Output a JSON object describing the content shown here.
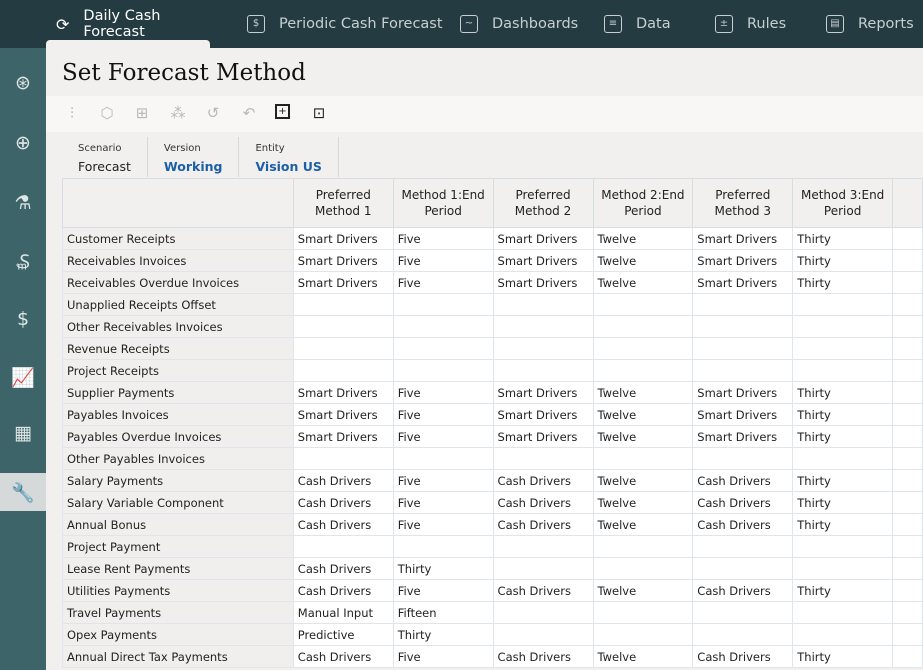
{
  "nav": {
    "tabs": [
      {
        "label": "Daily Cash Forecast",
        "icon": "cash-cycle-icon",
        "active": true
      },
      {
        "label": "Periodic Cash Forecast",
        "icon": "calendar-dollar-icon"
      },
      {
        "label": "Dashboards",
        "icon": "monitor-chart-icon"
      },
      {
        "label": "Data",
        "icon": "table-icon"
      },
      {
        "label": "Rules",
        "icon": "calculator-icon"
      },
      {
        "label": "Reports",
        "icon": "report-icon"
      }
    ]
  },
  "sidebar": {
    "items": [
      {
        "icon": "cash-flow-icon"
      },
      {
        "icon": "add-circle-icon"
      },
      {
        "icon": "lab-flask-icon"
      },
      {
        "icon": "invoice-dollar-icon"
      },
      {
        "icon": "balance-dollar-icon"
      },
      {
        "icon": "line-chart-icon"
      },
      {
        "icon": "grid-icon"
      },
      {
        "icon": "wrench-icon",
        "active": true
      }
    ]
  },
  "page": {
    "title": "Set Forecast Method"
  },
  "toolbar": {
    "icons": [
      "adjust-sliders-icon",
      "cube-icon",
      "add-comment-icon",
      "hierarchy-icon",
      "history-icon",
      "undo-icon",
      "grid-focus-icon",
      "panel-export-icon"
    ]
  },
  "pov": {
    "scenario_label": "Scenario",
    "scenario": "Forecast",
    "version_label": "Version",
    "version": "Working",
    "entity_label": "Entity",
    "entity": "Vision US"
  },
  "grid": {
    "columns": [
      "Preferred Method 1",
      "Method 1:End Period",
      "Preferred Method 2",
      "Method 2:End Period",
      "Preferred Method 3",
      "Method 3:End Period"
    ],
    "rows": [
      [
        "Customer Receipts",
        "Smart Drivers",
        "Five",
        "Smart Drivers",
        "Twelve",
        "Smart Drivers",
        "Thirty"
      ],
      [
        "Receivables Invoices",
        "Smart Drivers",
        "Five",
        "Smart Drivers",
        "Twelve",
        "Smart Drivers",
        "Thirty"
      ],
      [
        "Receivables Overdue Invoices",
        "Smart Drivers",
        "Five",
        "Smart Drivers",
        "Twelve",
        "Smart Drivers",
        "Thirty"
      ],
      [
        "Unapplied Receipts Offset",
        "",
        "",
        "",
        "",
        "",
        ""
      ],
      [
        "Other Receivables Invoices",
        "",
        "",
        "",
        "",
        "",
        ""
      ],
      [
        "Revenue Receipts",
        "",
        "",
        "",
        "",
        "",
        ""
      ],
      [
        "Project Receipts",
        "",
        "",
        "",
        "",
        "",
        ""
      ],
      [
        "Supplier Payments",
        "Smart Drivers",
        "Five",
        "Smart Drivers",
        "Twelve",
        "Smart Drivers",
        "Thirty"
      ],
      [
        "Payables Invoices",
        "Smart Drivers",
        "Five",
        "Smart Drivers",
        "Twelve",
        "Smart Drivers",
        "Thirty"
      ],
      [
        "Payables Overdue Invoices",
        "Smart Drivers",
        "Five",
        "Smart Drivers",
        "Twelve",
        "Smart Drivers",
        "Thirty"
      ],
      [
        "Other Payables Invoices",
        "",
        "",
        "",
        "",
        "",
        ""
      ],
      [
        "Salary Payments",
        "Cash Drivers",
        "Five",
        "Cash Drivers",
        "Twelve",
        "Cash Drivers",
        "Thirty"
      ],
      [
        "Salary Variable Component",
        "Cash Drivers",
        "Five",
        "Cash Drivers",
        "Twelve",
        "Cash Drivers",
        "Thirty"
      ],
      [
        "Annual Bonus",
        "Cash Drivers",
        "Five",
        "Cash Drivers",
        "Twelve",
        "Cash Drivers",
        "Thirty"
      ],
      [
        "Project Payment",
        "",
        "",
        "",
        "",
        "",
        ""
      ],
      [
        "Lease Rent Payments",
        "Cash Drivers",
        "Thirty",
        "",
        "",
        "",
        ""
      ],
      [
        "Utilities Payments",
        "Cash Drivers",
        "Five",
        "Cash Drivers",
        "Twelve",
        "Cash Drivers",
        "Thirty"
      ],
      [
        "Travel Payments",
        "Manual Input",
        "Fifteen",
        "",
        "",
        "",
        ""
      ],
      [
        "Opex Payments",
        "Predictive",
        "Thirty",
        "",
        "",
        "",
        ""
      ],
      [
        "Annual Direct Tax Payments",
        "Cash Drivers",
        "Five",
        "Cash Drivers",
        "Twelve",
        "Cash Drivers",
        "Thirty"
      ]
    ]
  }
}
